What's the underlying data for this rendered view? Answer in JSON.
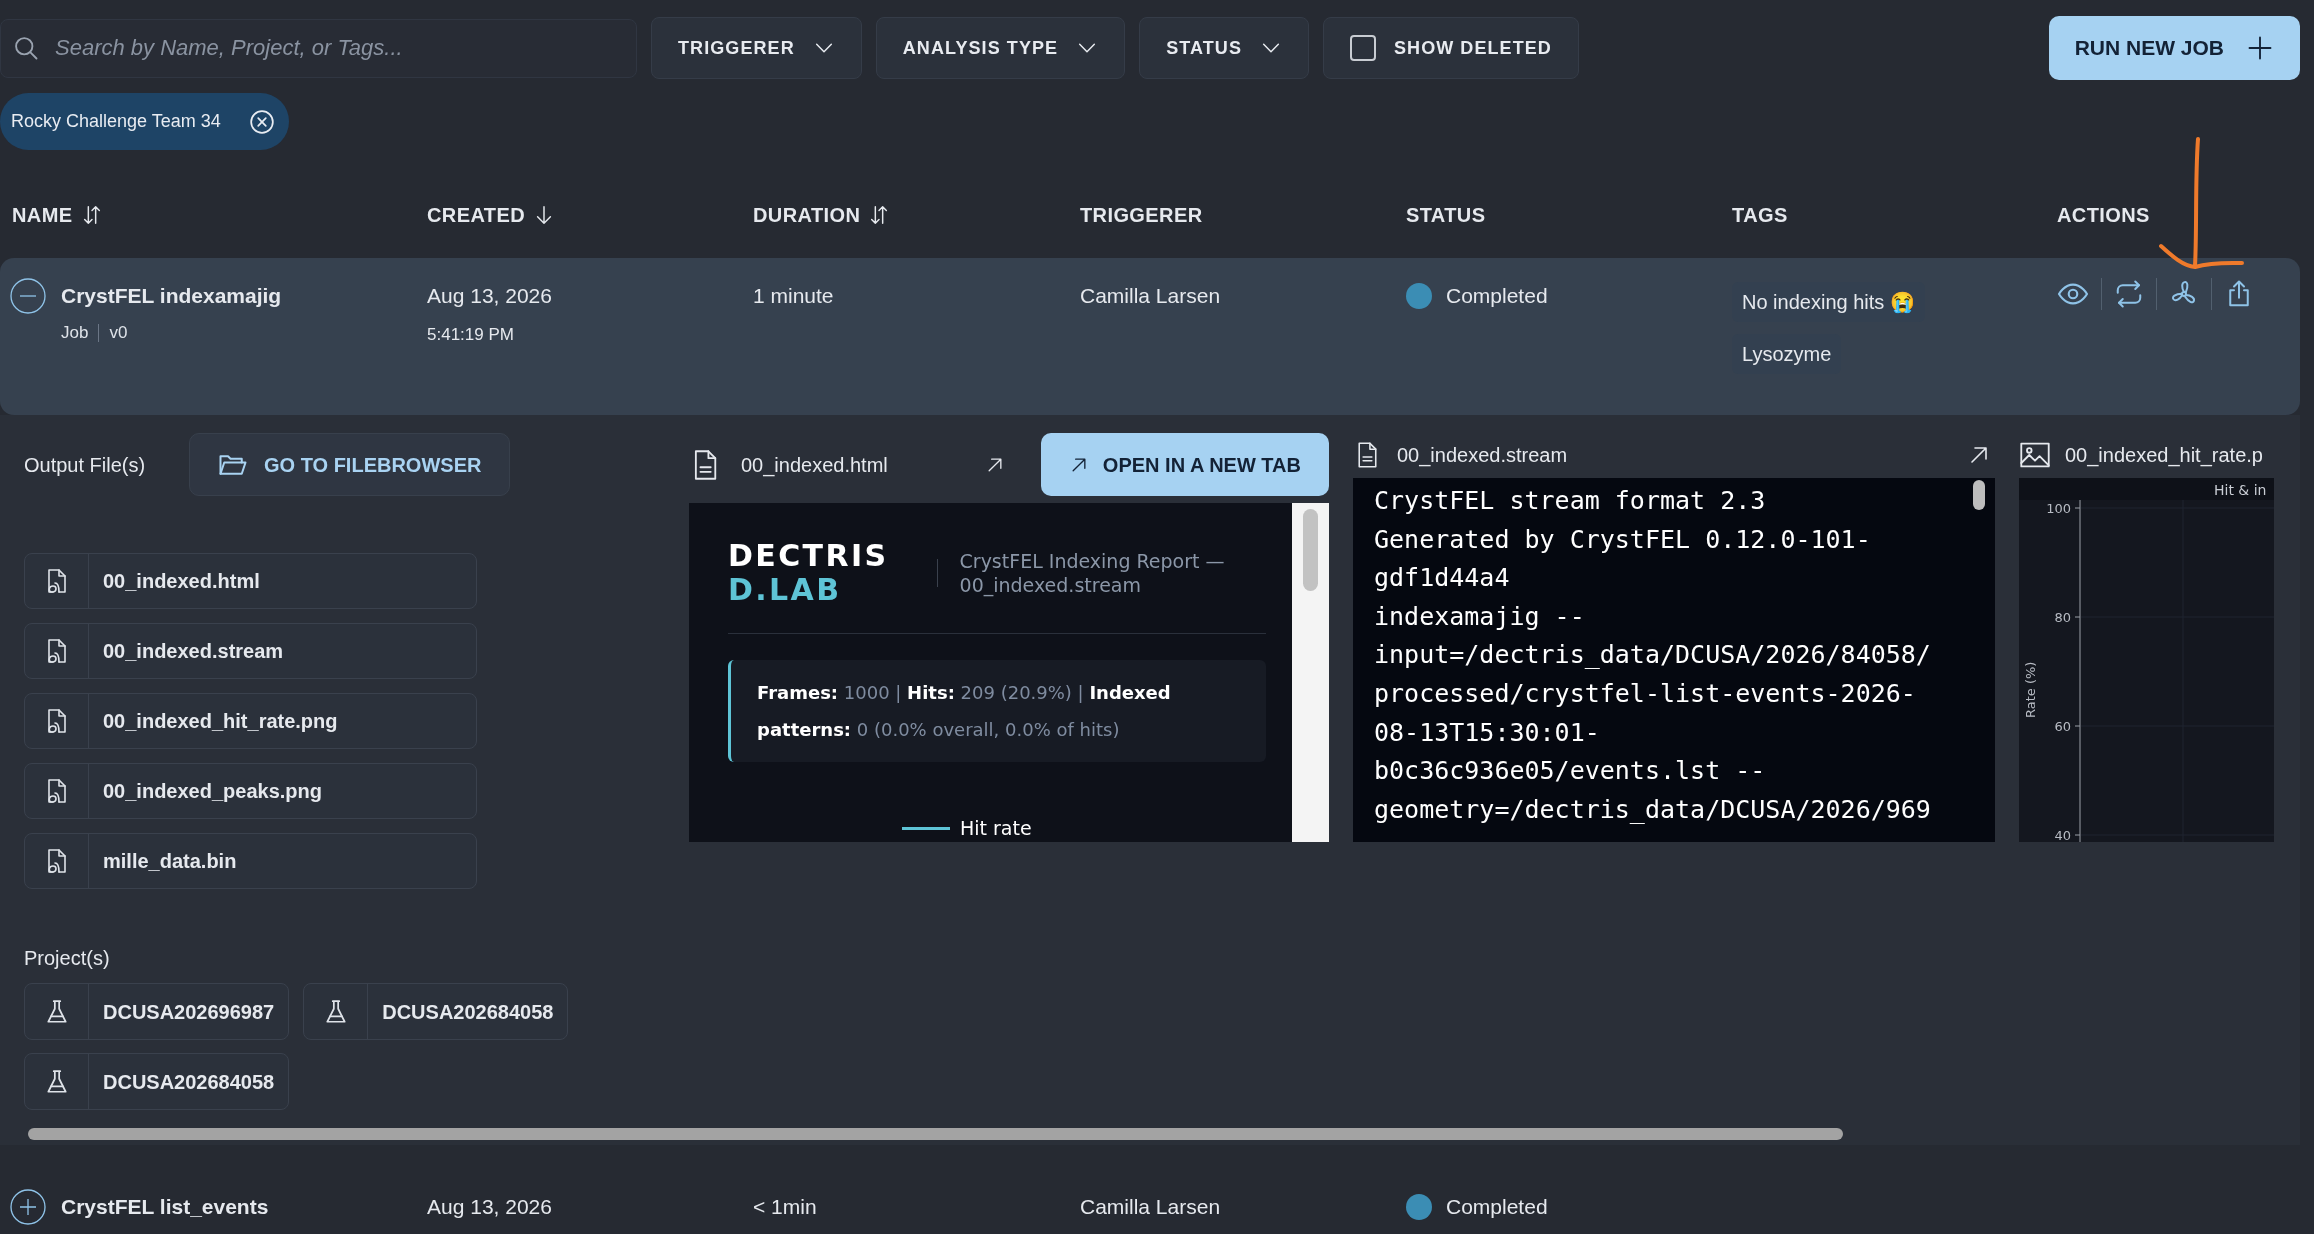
{
  "search": {
    "placeholder": "Search by Name, Project, or Tags..."
  },
  "filters": [
    {
      "kind": "dropdown",
      "label": "TRIGGERER"
    },
    {
      "kind": "dropdown",
      "label": "ANALYSIS TYPE"
    },
    {
      "kind": "dropdown",
      "label": "STATUS"
    },
    {
      "kind": "checkbox",
      "label": "SHOW DELETED",
      "checked": false
    }
  ],
  "run_button": "RUN NEW JOB",
  "active_filters": [
    {
      "label": "Rocky Challenge Team 34"
    }
  ],
  "columns": [
    {
      "label": "NAME",
      "kind": "sortable"
    },
    {
      "label": "CREATED",
      "kind": "descending"
    },
    {
      "label": "DURATION",
      "kind": "sortable"
    },
    {
      "label": "TRIGGERER",
      "kind": "plain"
    },
    {
      "label": "STATUS",
      "kind": "plain"
    },
    {
      "label": "TAGS",
      "kind": "plain"
    },
    {
      "label": "ACTIONS",
      "kind": "plain"
    }
  ],
  "rows": [
    {
      "name": "CrystFEL indexamajig",
      "type": "Job",
      "version": "v0",
      "date": "Aug 13, 2026",
      "time": "5:41:19 PM",
      "duration": "1 minute",
      "triggerer": "Camilla Larsen",
      "status": "Completed",
      "color": "#3b8db4",
      "tags": [
        "No indexing hits 😭",
        "Lysozyme"
      ],
      "expanded": true,
      "details": {
        "output_label": "Output File(s)",
        "filebrowser_button": "GO TO FILEBROWSER",
        "files": [
          "00_indexed.html",
          "00_indexed.stream",
          "00_indexed_hit_rate.png",
          "00_indexed_peaks.png",
          "mille_data.bin"
        ],
        "projects_label": "Project(s)",
        "projects": [
          "DCUSA202696987",
          "DCUSA202684058",
          "DCUSA202684058"
        ],
        "previews": [
          {
            "kind": "html",
            "file": "00_indexed.html",
            "open_button": "OPEN IN A NEW TAB",
            "brand": "DECTRIS",
            "brand_sub": "D.LAB",
            "report_title": "CrystFEL Indexing Report — 00_indexed.stream",
            "summary": "**Frames:** 1000 | **Hits:** 209 (20.9%) | **Indexed patterns:** 0 (0.0% overall, 0.0% of hits)",
            "legend": "Hit rate"
          },
          {
            "kind": "text",
            "file": "00_indexed.stream",
            "lines": [
              "CrystFEL stream format 2.3",
              "Generated by CrystFEL 0.12.0-101-",
              "gdf1d44a4",
              "indexamajig --",
              "input=/dectris_data/DCUSA/2026/84058/",
              "processed/crystfel-list-events-2026-",
              "08-13T15:30:01-",
              "b0c36c936e05/events.lst --",
              "geometry=/dectris_data/DCUSA/2026/969"
            ]
          },
          {
            "kind": "image",
            "file": "00_indexed_hit_rate.p",
            "chart_title": "Hit & in",
            "ylabel": "Rate (%)",
            "yticks": [
              "100",
              "80",
              "60",
              "40"
            ]
          }
        ]
      }
    },
    {
      "name": "CrystFEL list_events",
      "date": "Aug 13, 2026",
      "duration": "< 1min",
      "triggerer": "Camilla Larsen",
      "status": "Completed",
      "color": "#3b8db4",
      "expanded": false
    }
  ]
}
